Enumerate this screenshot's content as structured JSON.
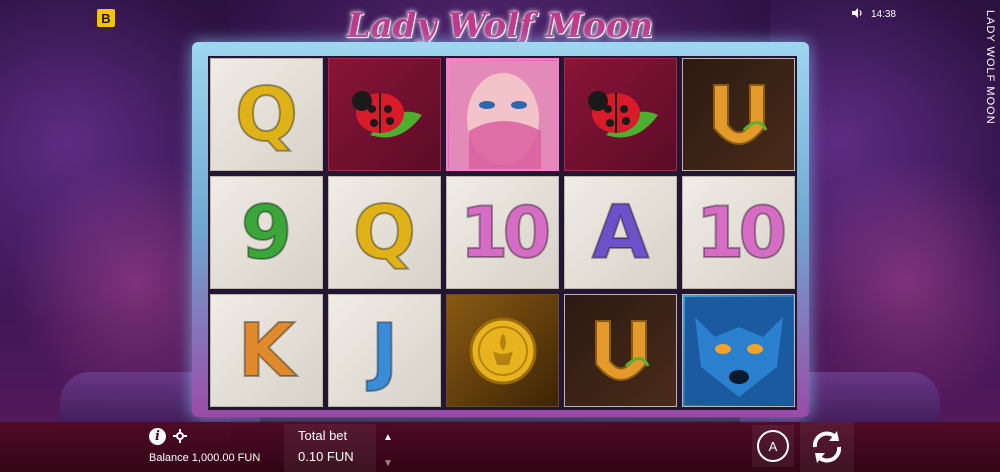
{
  "brand": {
    "badge": "B"
  },
  "status": {
    "time": "14:38",
    "sound_icon": "speaker-icon"
  },
  "side_title": "LADY WOLF MOON",
  "game": {
    "title": "Lady Wolf Moon"
  },
  "reels": [
    [
      "Q",
      "ladybug",
      "lady",
      "ladybug",
      "horseshoe"
    ],
    [
      "9",
      "Q",
      "10",
      "A",
      "10"
    ],
    [
      "K",
      "J",
      "coin",
      "horseshoe",
      "wolf"
    ]
  ],
  "footer": {
    "info_label": "i",
    "settings_icon": "gear-icon",
    "balance_text": "Balance 1,000.00 FUN",
    "total_bet_label": "Total bet",
    "total_bet_value": "0.10 FUN",
    "bet_up_icon": "triangle-up-icon",
    "bet_down_icon": "triangle-down-icon",
    "auto_label": "A",
    "spin_icon": "spin-arrows-icon"
  }
}
